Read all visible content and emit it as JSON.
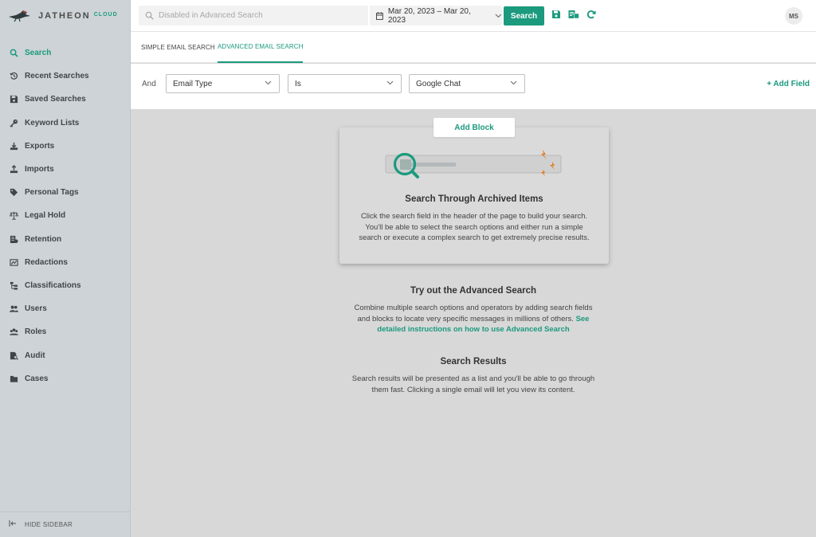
{
  "brand": {
    "name": "JATHEON",
    "suffix": "CLOUD"
  },
  "sidebar": {
    "items": [
      {
        "label": "Search",
        "icon": "search-icon",
        "active": true
      },
      {
        "label": "Recent Searches",
        "icon": "history-icon"
      },
      {
        "label": "Saved Searches",
        "icon": "save-icon"
      },
      {
        "label": "Keyword Lists",
        "icon": "key-icon"
      },
      {
        "label": "Exports",
        "icon": "export-icon"
      },
      {
        "label": "Imports",
        "icon": "import-icon"
      },
      {
        "label": "Personal Tags",
        "icon": "tag-icon"
      },
      {
        "label": "Legal Hold",
        "icon": "scale-icon"
      },
      {
        "label": "Retention",
        "icon": "retention-icon"
      },
      {
        "label": "Redactions",
        "icon": "redaction-icon"
      },
      {
        "label": "Classifications",
        "icon": "classification-icon"
      },
      {
        "label": "Users",
        "icon": "users-icon"
      },
      {
        "label": "Roles",
        "icon": "roles-icon"
      },
      {
        "label": "Audit",
        "icon": "audit-icon"
      },
      {
        "label": "Cases",
        "icon": "folder-icon"
      }
    ],
    "hide_label": "HIDE SIDEBAR"
  },
  "topbar": {
    "search_placeholder": "Disabled in Advanced Search",
    "date_range": "Mar 20, 2023 – Mar 20, 2023",
    "search_button": "Search",
    "avatar": "MS"
  },
  "tabs": [
    {
      "label": "SIMPLE EMAIL SEARCH",
      "active": false
    },
    {
      "label": "ADVANCED EMAIL SEARCH",
      "active": true
    }
  ],
  "filter": {
    "and_label": "And",
    "field": "Email Type",
    "operator": "Is",
    "value": "Google Chat",
    "add_field": "+ Add Field"
  },
  "main": {
    "add_block": "Add Block",
    "card_title": "Search Through Archived Items",
    "card_text": "Click the search field in the header of the page to build your search. You'll be able to select the search options and either run a simple search or execute a complex search to get extremely precise results.",
    "advanced_title": "Try out the Advanced Search",
    "advanced_text": "Combine multiple search options and operators by adding search fields and blocks to locate very specific messages in millions of others.",
    "advanced_link": "See detailed instructions on how to use Advanced Search",
    "results_title": "Search Results",
    "results_text": "Search results will be presented as a list and you'll be able to go through them fast. Clicking a single email will let you view its content."
  },
  "colors": {
    "accent": "#1b9a7e",
    "sidebar_bg": "#cdd3d6",
    "main_bg": "#d8d8d8",
    "lightning": "#e07b22"
  }
}
